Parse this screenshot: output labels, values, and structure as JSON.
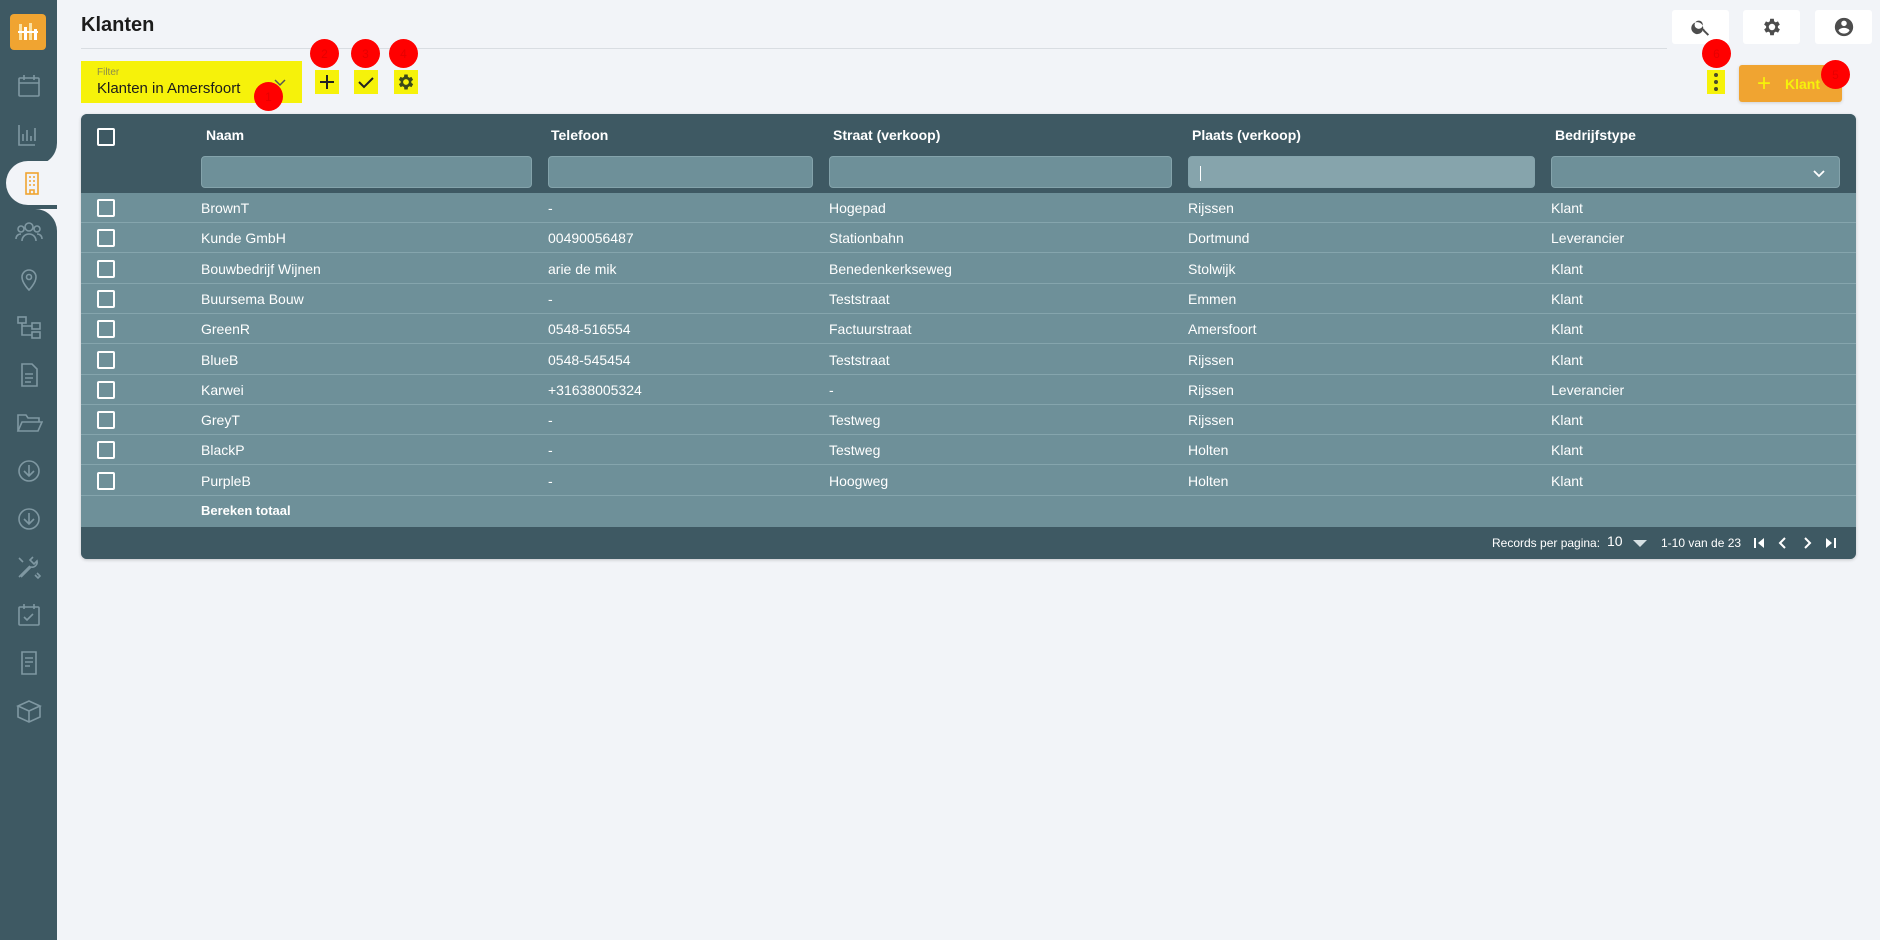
{
  "sidebar": {
    "logo_name": "logo-icon",
    "items": [
      {
        "icon": "calendar-icon"
      },
      {
        "icon": "bar-chart-icon"
      },
      {
        "icon": "building-icon",
        "active": true
      },
      {
        "icon": "people-icon"
      },
      {
        "icon": "location-pin-icon"
      },
      {
        "icon": "hierarchy-icon"
      },
      {
        "icon": "document-icon"
      },
      {
        "icon": "folder-open-icon"
      },
      {
        "icon": "download-circle-icon"
      },
      {
        "icon": "download-circle-icon-2"
      },
      {
        "icon": "tools-icon"
      },
      {
        "icon": "calendar-check-icon"
      },
      {
        "icon": "invoice-icon"
      },
      {
        "icon": "box-icon"
      }
    ],
    "accent": "#f0a431",
    "background": "#3e5963"
  },
  "header": {
    "title": "Klanten",
    "buttons": [
      "search-icon",
      "gear-icon",
      "user-icon"
    ]
  },
  "toolbar": {
    "filter_label": "Filter",
    "filter_value": "Klanten in Amersfoort",
    "add_button_label": "Klant",
    "highlight_color": "#f6f20a",
    "markers": [
      "1",
      "2",
      "3",
      "4",
      "5",
      "6"
    ]
  },
  "table": {
    "columns": [
      "Naam",
      "Telefoon",
      "Straat (verkoop)",
      "Plaats (verkoop)",
      "Bedrijfstype"
    ],
    "rows": [
      [
        "BrownT",
        "-",
        "Hogepad",
        "Rijssen",
        "Klant"
      ],
      [
        "Kunde GmbH",
        "00490056487",
        "Stationbahn",
        "Dortmund",
        "Leverancier"
      ],
      [
        "Bouwbedrijf Wijnen",
        "arie de mik",
        "Benedenkerkseweg",
        "Stolwijk",
        "Klant"
      ],
      [
        "Buursema Bouw",
        "-",
        "Teststraat",
        "Emmen",
        "Klant"
      ],
      [
        "GreenR",
        "0548-516554",
        "Factuurstraat",
        "Amersfoort",
        "Klant"
      ],
      [
        "BlueB",
        "0548-545454",
        "Teststraat",
        "Rijssen",
        "Klant"
      ],
      [
        "Karwei",
        "+31638005324",
        "-",
        "Rijssen",
        "Leverancier"
      ],
      [
        "GreyT",
        "-",
        "Testweg",
        "Rijssen",
        "Klant"
      ],
      [
        "BlackP",
        "-",
        "Testweg",
        "Holten",
        "Klant"
      ],
      [
        "PurpleB",
        "-",
        "Hoogweg",
        "Holten",
        "Klant"
      ]
    ],
    "total_label": "Bereken totaal"
  },
  "pagination": {
    "records_label": "Records per pagina:",
    "per_page": "10",
    "range": "1-10 van de 23"
  }
}
